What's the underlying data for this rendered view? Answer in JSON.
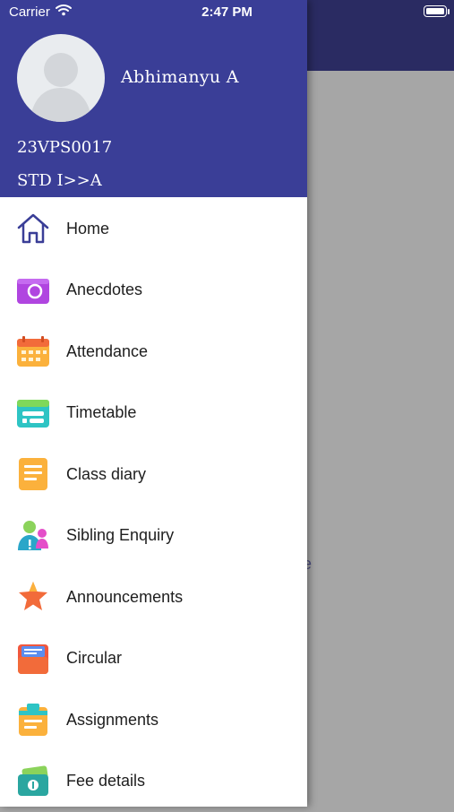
{
  "status_bar": {
    "carrier": "Carrier",
    "time": "2:47 PM"
  },
  "profile": {
    "name": "Abhimanyu A",
    "id": "23VPS0017",
    "class": "STD I>>A"
  },
  "menu": [
    {
      "label": "Home",
      "icon": "home-icon"
    },
    {
      "label": "Anecdotes",
      "icon": "camera-icon"
    },
    {
      "label": "Attendance",
      "icon": "calendar-icon"
    },
    {
      "label": "Timetable",
      "icon": "timetable-icon"
    },
    {
      "label": "Class diary",
      "icon": "diary-icon"
    },
    {
      "label": "Sibling Enquiry",
      "icon": "sibling-icon"
    },
    {
      "label": "Announcements",
      "icon": "star-icon"
    },
    {
      "label": "Circular",
      "icon": "circular-icon"
    },
    {
      "label": "Assignments",
      "icon": "clipboard-icon"
    },
    {
      "label": "Fee details",
      "icon": "money-icon"
    }
  ],
  "background": {
    "fragment_text": "e"
  },
  "colors": {
    "drawer_header": "#3a3e97",
    "app_header": "#2a2b62"
  }
}
